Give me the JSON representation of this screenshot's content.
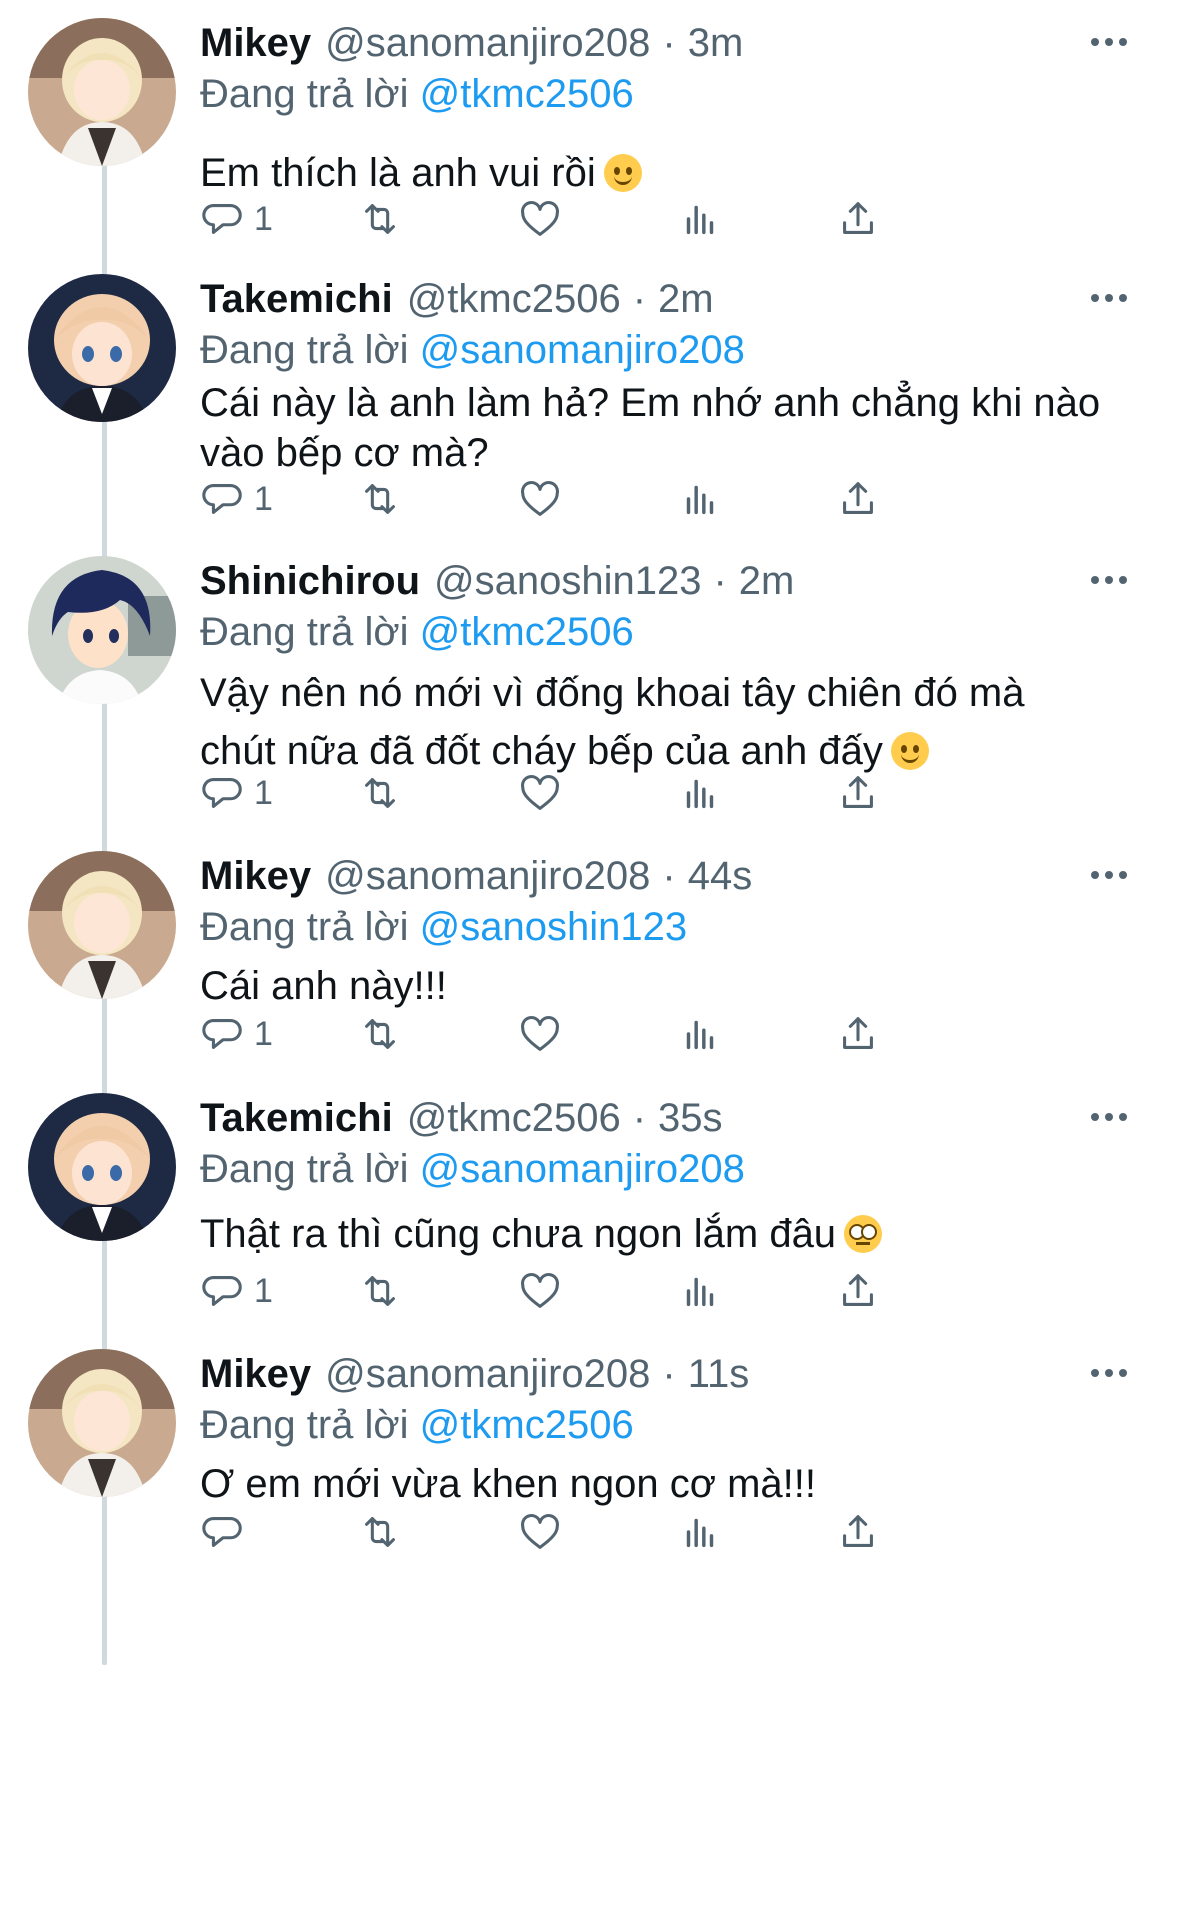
{
  "tweets": [
    {
      "name": "Mikey",
      "handle": "@sanomanjiro208",
      "time": "3m",
      "reply_prefix": "Đang trả lời",
      "reply_to": "@tkmc2506",
      "text": "Em thích là anh vui rồi",
      "emoji": "relieved-face",
      "reply_count": "1",
      "avatar": "mikey-avatar"
    },
    {
      "name": "Takemichi",
      "handle": "@tkmc2506",
      "time": "2m",
      "reply_prefix": "Đang trả lời",
      "reply_to": "@sanomanjiro208",
      "text": "Cái này là anh làm hả? Em nhớ anh chẳng khi nào vào bếp cơ mà?",
      "reply_count": "1",
      "avatar": "takemichi-avatar"
    },
    {
      "name": "Shinichirou",
      "handle": "@sanoshin123",
      "time": "2m",
      "reply_prefix": "Đang trả lời",
      "reply_to": "@tkmc2506",
      "text": "Vậy nên nó mới vì đống khoai tây chiên đó mà chút nữa đã đốt cháy bếp của anh đấy",
      "emoji": "slightly-smiling-face",
      "reply_count": "1",
      "avatar": "shinichirou-avatar"
    },
    {
      "name": "Mikey",
      "handle": "@sanomanjiro208",
      "time": "44s",
      "reply_prefix": "Đang trả lời",
      "reply_to": "@sanoshin123",
      "text": "Cái anh này!!!",
      "reply_count": "1",
      "avatar": "mikey-avatar"
    },
    {
      "name": "Takemichi",
      "handle": "@tkmc2506",
      "time": "35s",
      "reply_prefix": "Đang trả lời",
      "reply_to": "@sanomanjiro208",
      "text": "Thật ra thì cũng chưa ngon lắm đâu",
      "emoji": "face-with-rolling-eyes",
      "reply_count": "1",
      "avatar": "takemichi-avatar"
    },
    {
      "name": "Mikey",
      "handle": "@sanomanjiro208",
      "time": "11s",
      "reply_prefix": "Đang trả lời",
      "reply_to": "@tkmc2506",
      "text": "Ơ em mới vừa khen ngon cơ mà!!!",
      "reply_count": "",
      "avatar": "mikey-avatar"
    }
  ],
  "colors": {
    "text": "#0f1419",
    "secondary": "#536471",
    "mention": "#1d9bf0",
    "thread_line": "#cfd9de"
  },
  "icons": {
    "reply": "reply-icon",
    "retweet": "retweet-icon",
    "like": "heart-icon",
    "views": "views-icon",
    "share": "share-icon",
    "more": "more-icon"
  }
}
